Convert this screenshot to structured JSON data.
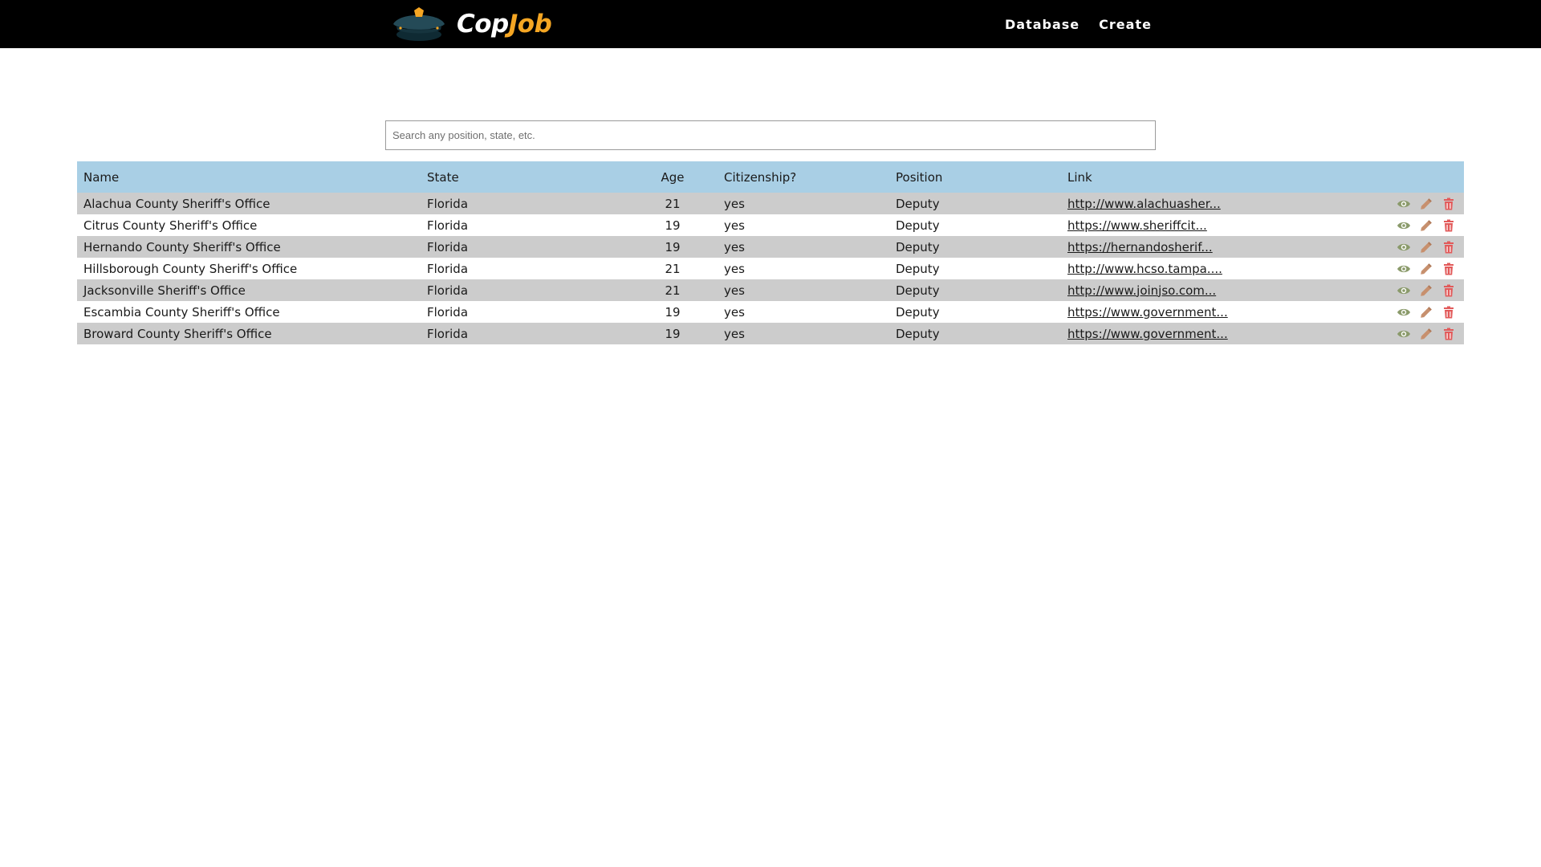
{
  "brand": {
    "name_part1": "Cop",
    "name_part2": "Job",
    "icon": "police-cap-icon",
    "accent_color": "#f5a623"
  },
  "nav": {
    "items": [
      {
        "label": "Database"
      },
      {
        "label": "Create"
      }
    ]
  },
  "search": {
    "placeholder": "Search any position, state, etc.",
    "value": ""
  },
  "table": {
    "header_color": "#a9cfe5",
    "columns": [
      "Name",
      "State",
      "Age",
      "Citizenship?",
      "Position",
      "Link"
    ],
    "actions": [
      "eye-icon",
      "pencil-icon",
      "trash-icon"
    ],
    "rows": [
      {
        "name": "Alachua County Sheriff's Office",
        "state": "Florida",
        "age": "21",
        "citizenship": "yes",
        "position": "Deputy",
        "link": "http://www.alachuasher..."
      },
      {
        "name": "Citrus County Sheriff's Office",
        "state": "Florida",
        "age": "19",
        "citizenship": "yes",
        "position": "Deputy",
        "link": "https://www.sheriffcit..."
      },
      {
        "name": "Hernando County Sheriff's Office",
        "state": "Florida",
        "age": "19",
        "citizenship": "yes",
        "position": "Deputy",
        "link": "https://hernandosherif..."
      },
      {
        "name": "Hillsborough County Sheriff's Office",
        "state": "Florida",
        "age": "21",
        "citizenship": "yes",
        "position": "Deputy",
        "link": "http://www.hcso.tampa...."
      },
      {
        "name": "Jacksonville Sheriff's Office",
        "state": "Florida",
        "age": "21",
        "citizenship": "yes",
        "position": "Deputy",
        "link": "http://www.joinjso.com..."
      },
      {
        "name": "Escambia County Sheriff's Office",
        "state": "Florida",
        "age": "19",
        "citizenship": "yes",
        "position": "Deputy",
        "link": "https://www.government..."
      },
      {
        "name": "Broward County Sheriff's Office",
        "state": "Florida",
        "age": "19",
        "citizenship": "yes",
        "position": "Deputy",
        "link": "https://www.government..."
      }
    ]
  }
}
